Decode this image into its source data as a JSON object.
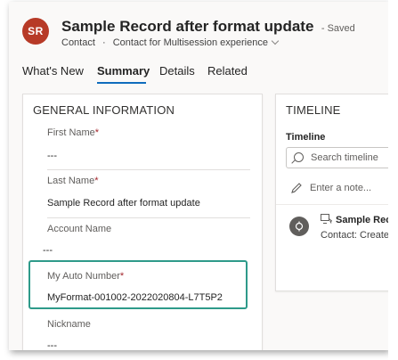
{
  "header": {
    "avatar_initials": "SR",
    "record_title": "Sample Record after format update",
    "save_status": "- Saved",
    "entity": "Contact",
    "separator": "·",
    "form_name": "Contact for Multisession experience"
  },
  "tabs": [
    {
      "label": "What's New"
    },
    {
      "label": "Summary",
      "active": true
    },
    {
      "label": "Details"
    },
    {
      "label": "Related"
    }
  ],
  "general": {
    "title": "GENERAL INFORMATION",
    "fields": [
      {
        "label": "First Name",
        "required": true,
        "value": "---"
      },
      {
        "label": "Last Name",
        "required": true,
        "value": "Sample Record after format update"
      },
      {
        "label": "Account Name",
        "required": false,
        "value": "---"
      },
      {
        "label": "My Auto Number",
        "required": true,
        "value": "MyFormat-001002-2022020804-L7T5P2"
      },
      {
        "label": "Nickname",
        "required": false,
        "value": "---"
      }
    ],
    "required_mark": "*"
  },
  "timeline": {
    "title": "TIMELINE",
    "label": "Timeline",
    "search_placeholder": "Search timeline",
    "note_placeholder": "Enter a note...",
    "item_title": "Sample Rec",
    "item_sub": "Contact: Create"
  },
  "colors": {
    "avatar": "#b73a27",
    "accent": "#0f6cbd",
    "highlight": "#2e9a8a",
    "required": "#a4262c"
  },
  "icons": [
    "search-icon",
    "pencil-icon",
    "record-icon",
    "contact-icon"
  ]
}
